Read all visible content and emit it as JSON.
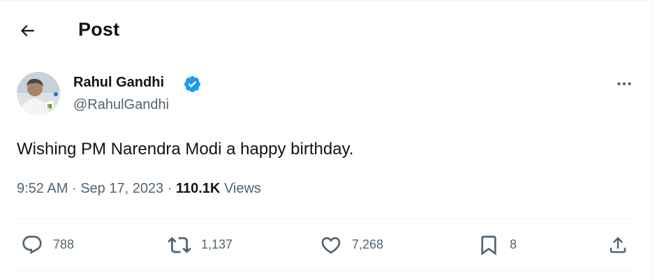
{
  "header": {
    "title": "Post",
    "back_icon": "arrow-left-icon"
  },
  "author": {
    "name": "Rahul Gandhi",
    "handle": "@RahulGandhi",
    "verified_icon": "verified-badge-icon",
    "verified_color": "#1d9bf0"
  },
  "post": {
    "text": "Wishing PM Narendra Modi a happy birthday.",
    "time": "9:52 AM",
    "separator": "·",
    "date": "Sep 17, 2023",
    "views_count": "110.1K",
    "views_label": "Views"
  },
  "more_icon": "more-horizontal-icon",
  "actions": {
    "replies": {
      "icon": "reply-icon",
      "count": "788"
    },
    "reposts": {
      "icon": "repost-icon",
      "count": "1,137"
    },
    "likes": {
      "icon": "heart-icon",
      "count": "7,268"
    },
    "bookmarks": {
      "icon": "bookmark-icon",
      "count": "8"
    },
    "share": {
      "icon": "share-icon"
    }
  },
  "colors": {
    "text_primary": "#0f1419",
    "text_secondary": "#536471",
    "divider": "#eff3f4"
  }
}
